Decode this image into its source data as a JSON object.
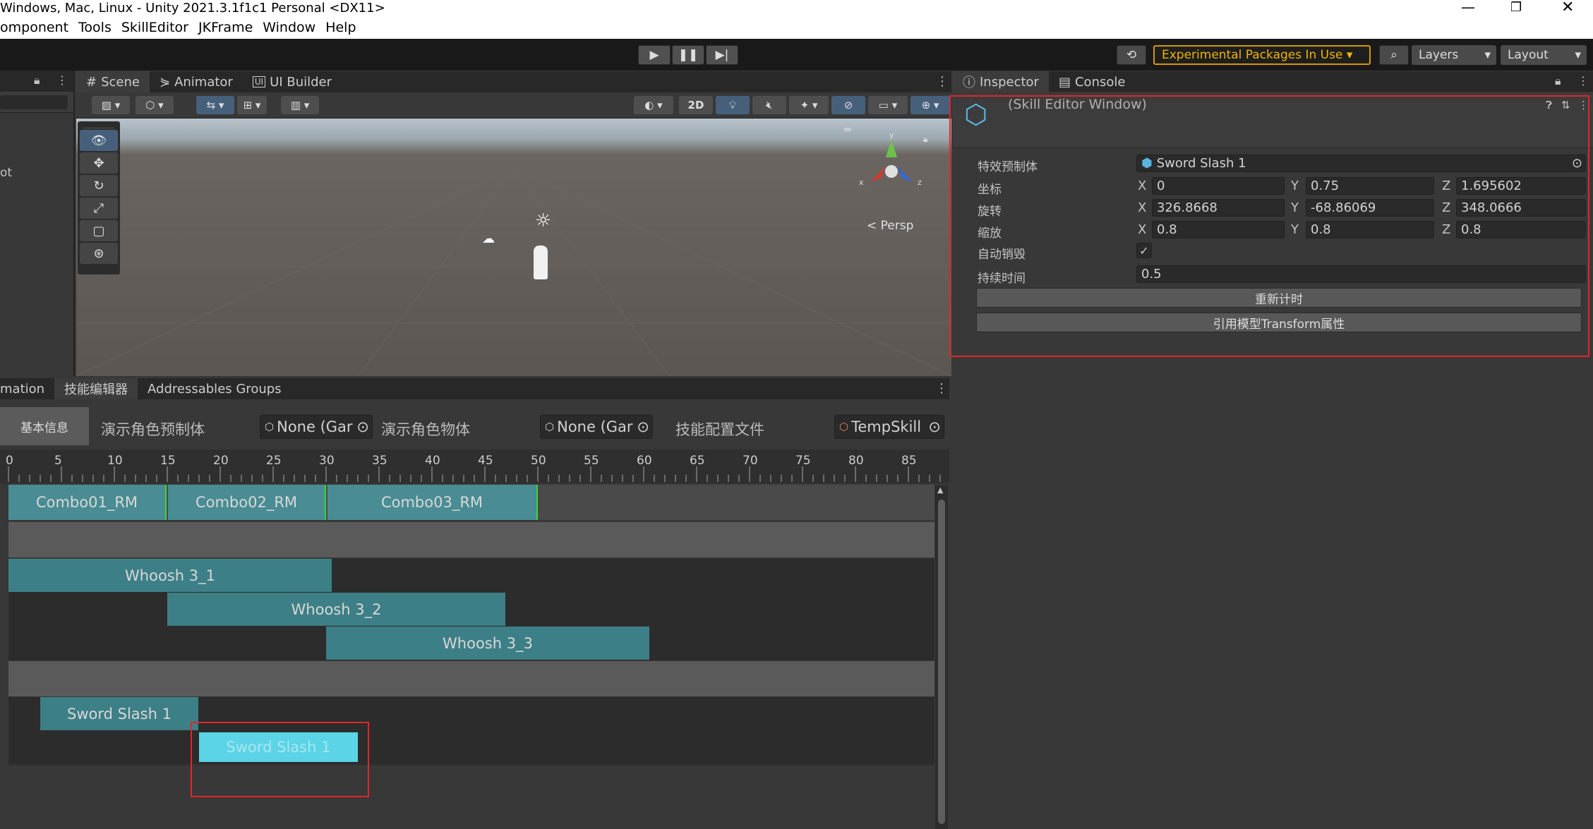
{
  "window": {
    "title": "Windows, Mac, Linux - Unity 2021.3.1f1c1 Personal <DX11>"
  },
  "menu": [
    "omponent",
    "Tools",
    "SkillEditor",
    "JKFrame",
    "Window",
    "Help"
  ],
  "toolbar": {
    "experimental": "Experimental Packages In Use ▾",
    "layers": "Layers",
    "layout": "Layout"
  },
  "scene_tabs": [
    "Scene",
    "Animator",
    "UI Builder"
  ],
  "scene": {
    "persp": "< Persp",
    "toggle_2d": "2D",
    "leftpanel_text": "ot"
  },
  "inspector_tabs": [
    "Inspector",
    "Console"
  ],
  "inspector": {
    "title": "(Skill Editor Window)",
    "prefab_label": "特效预制体",
    "prefab_value": "Sword Slash 1",
    "position_label": "坐标",
    "rotation_label": "旋转",
    "scale_label": "缩放",
    "auto_destroy_label": "自动销毁",
    "duration_label": "持续时间",
    "duration_value": "0.5",
    "position": {
      "x": "0",
      "y": "0.75",
      "z": "1.695602"
    },
    "rotation": {
      "x": "326.8668",
      "y": "-68.86069",
      "z": "348.0666"
    },
    "scale": {
      "x": "0.8",
      "y": "0.8",
      "z": "0.8"
    },
    "reset_button": "重新计时",
    "apply_button": "引用模型Transform属性"
  },
  "bottom_tabs": [
    "mation",
    "技能编辑器",
    "Addressables Groups"
  ],
  "skill_editor": {
    "basic_info": "基本信息",
    "demo_prefab_label": "演示角色预制体",
    "demo_prefab_value": "None (Gar",
    "demo_object_label": "演示角色物体",
    "demo_object_value": "None (Gar",
    "config_label": "技能配置文件",
    "config_value": "TempSkill",
    "ruler_ticks": [
      "0",
      "5",
      "10",
      "15",
      "20",
      "25",
      "30",
      "35",
      "40",
      "45",
      "50",
      "55",
      "60",
      "65",
      "70",
      "75",
      "80",
      "85"
    ],
    "clips": {
      "anim": [
        "Combo01_RM",
        "Combo02_RM",
        "Combo03_RM"
      ],
      "audio": [
        "Whoosh 3_1",
        "Whoosh 3_2",
        "Whoosh 3_3"
      ],
      "effect1": "Sword Slash 1",
      "effect2": "Sword Slash 1"
    }
  }
}
